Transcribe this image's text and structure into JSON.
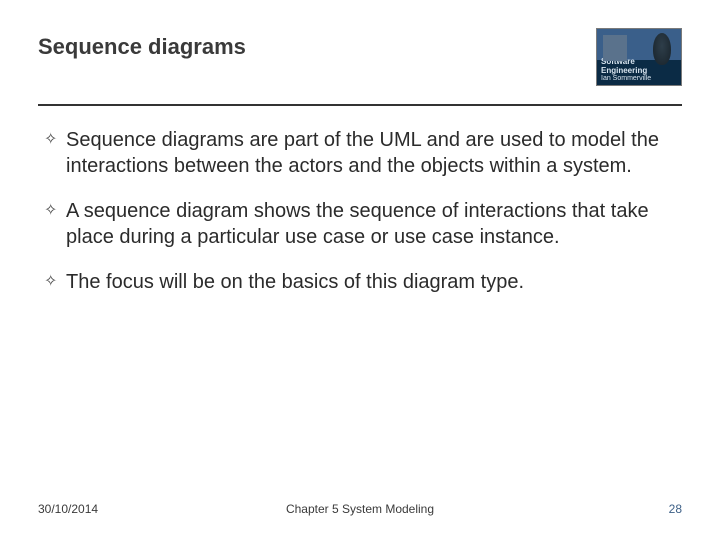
{
  "header": {
    "title": "Sequence diagrams",
    "logo": {
      "line1": "Software Engineering",
      "line2": "Ian Sommerville"
    }
  },
  "bullets": [
    "Sequence diagrams are part of the UML and are used to model the interactions between the actors and the objects within a system.",
    "A sequence diagram shows the sequence of interactions that take place during a particular use case or use case instance.",
    "The focus will be on the basics of this diagram type."
  ],
  "footer": {
    "date": "30/10/2014",
    "chapter": "Chapter 5 System Modeling",
    "page": "28"
  }
}
